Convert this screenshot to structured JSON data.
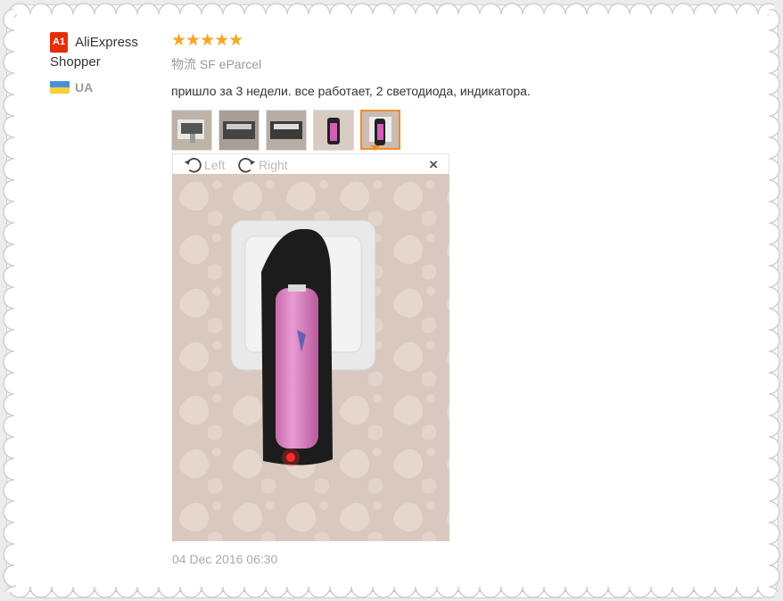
{
  "user": {
    "badge": "A1",
    "name": "AliExpress Shopper",
    "country": "UA"
  },
  "review": {
    "rating_stars": "★★★★★",
    "rating": 5,
    "logistics_label": "物流",
    "logistics_value": "SF eParcel",
    "text": "пришло за 3 недели. все работает, 2 светодиода, индикатора.",
    "thumbnails": [
      "photo-1",
      "photo-2",
      "photo-3",
      "photo-4",
      "photo-5"
    ],
    "active_thumbnail": 5,
    "date": "04 Dec 2016 06:30"
  },
  "viewer": {
    "rotate_left": "Left",
    "rotate_right": "Right",
    "close": "×"
  },
  "colors": {
    "accent_orange": "#f08c2f",
    "star": "#f5a623",
    "badge_red": "#e62e04"
  }
}
